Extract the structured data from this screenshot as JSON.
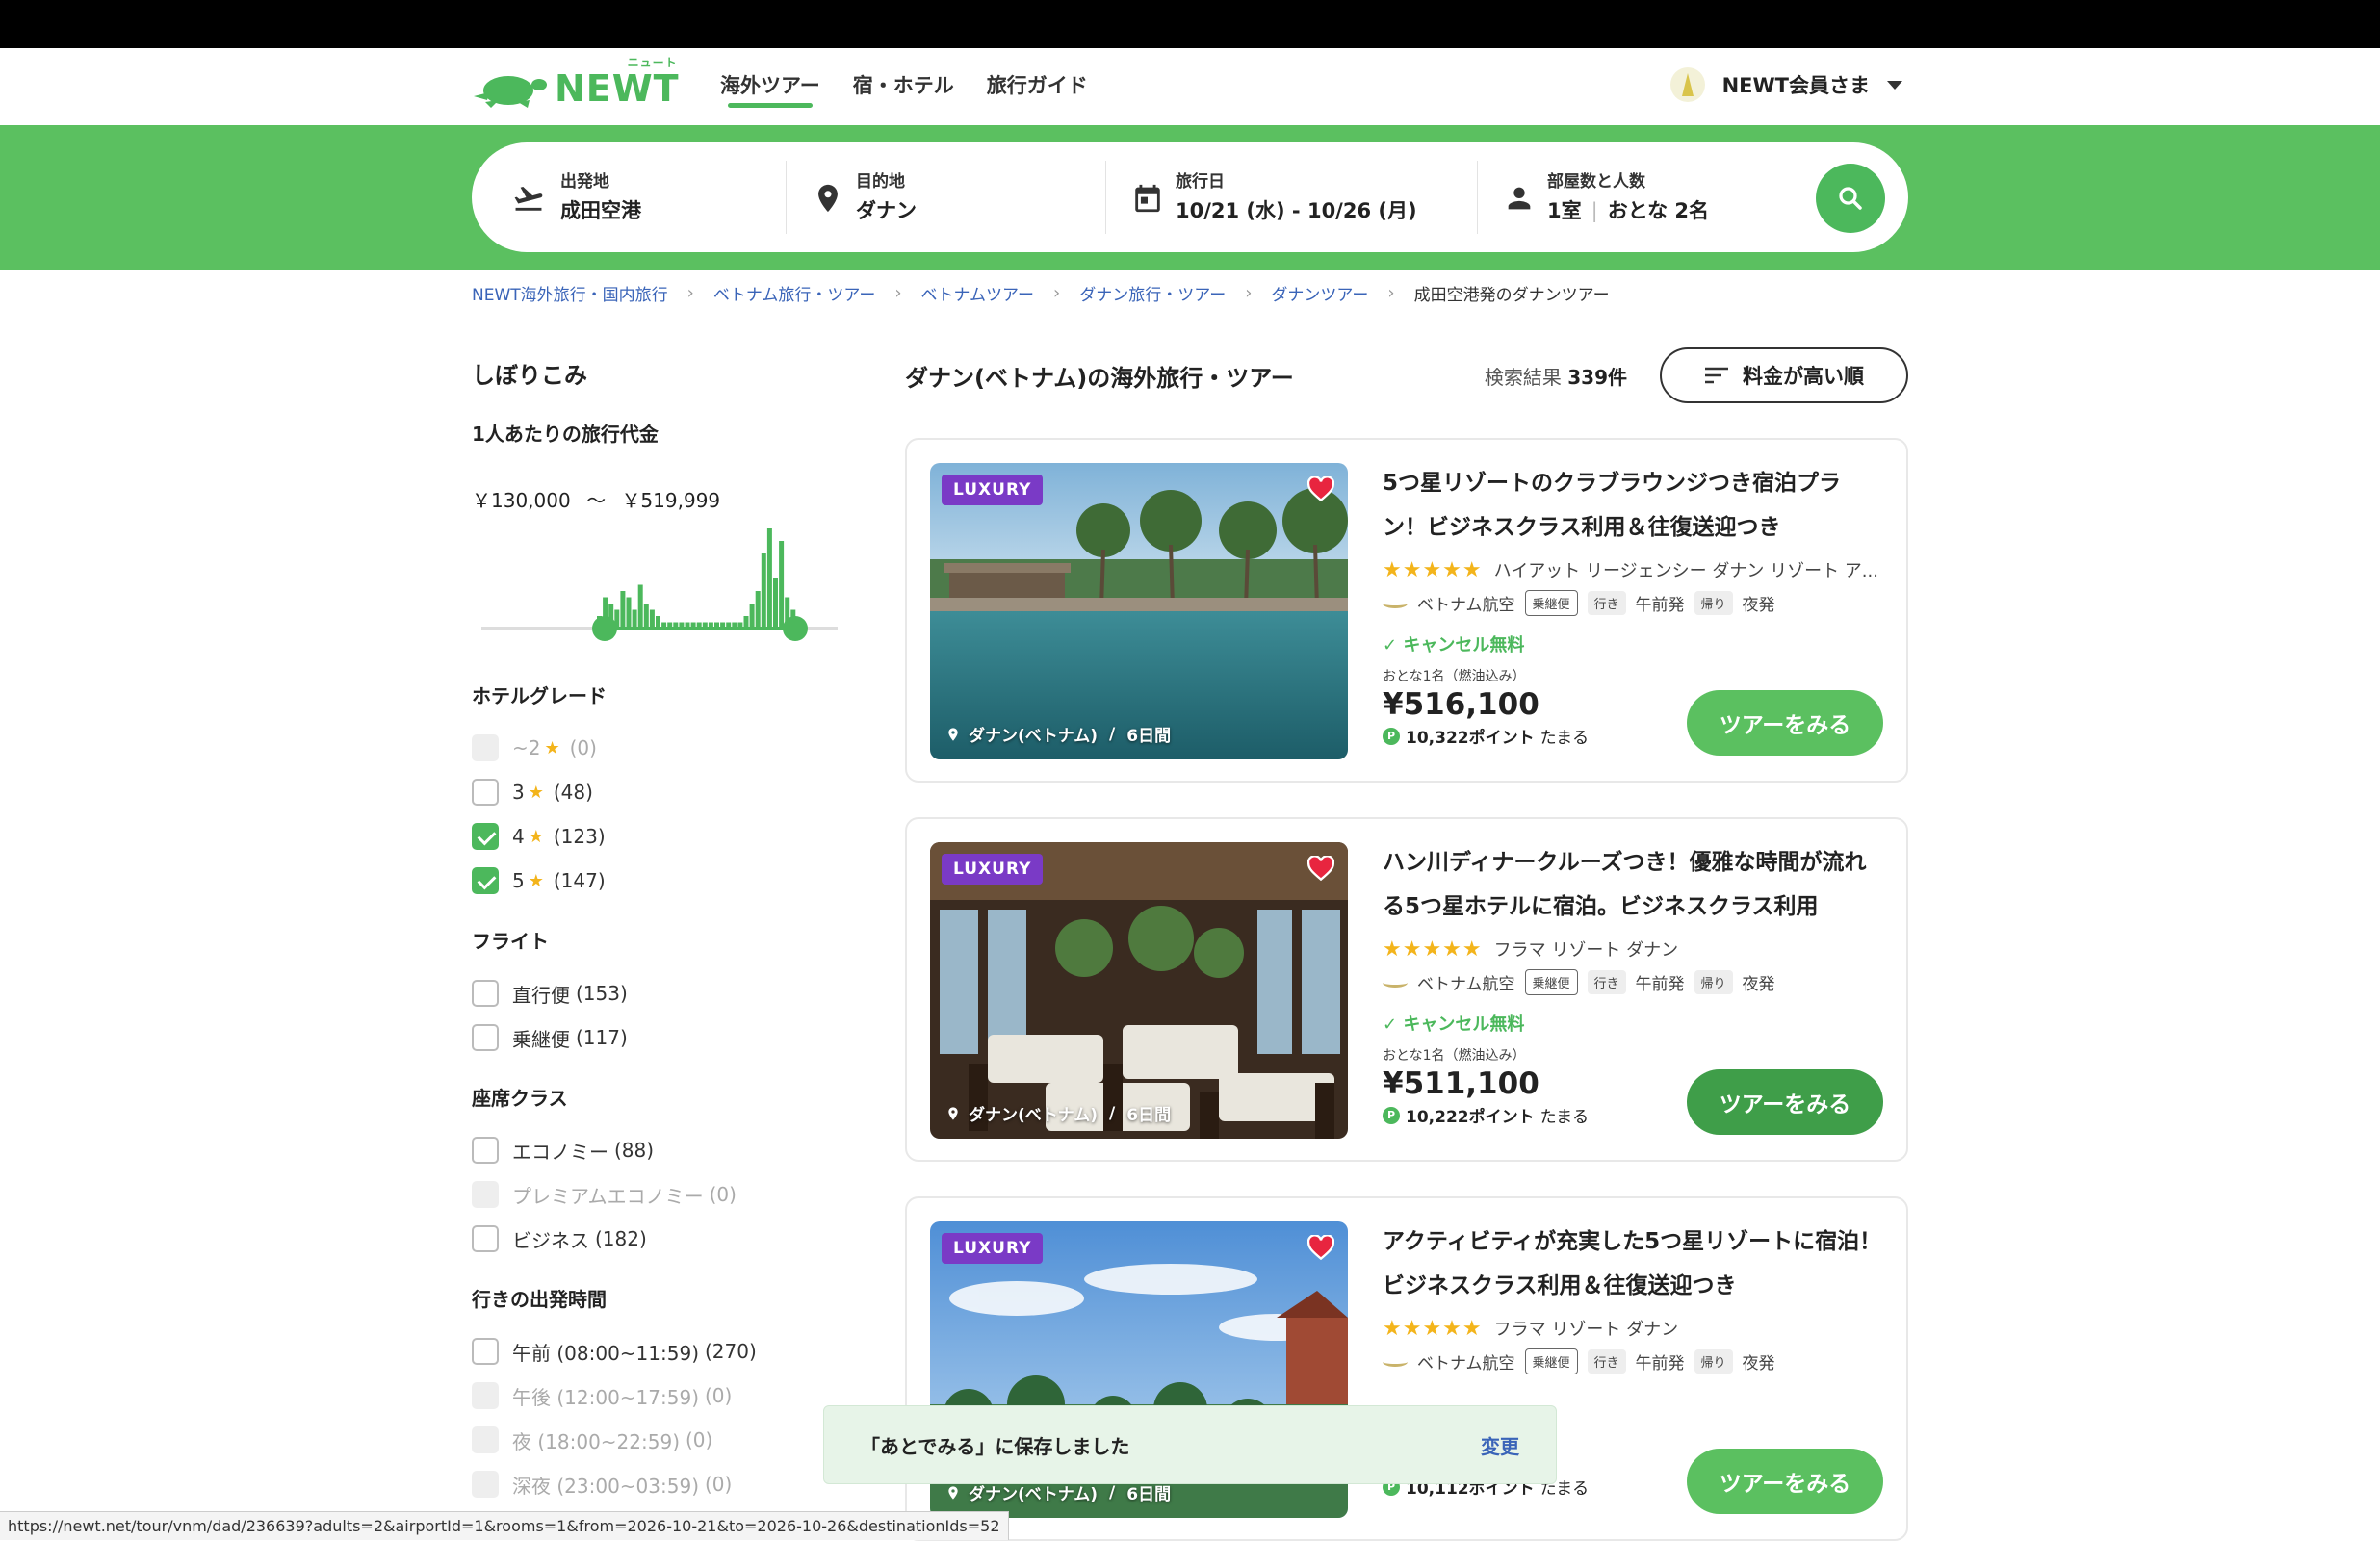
{
  "header": {
    "logo_text": "NEWT",
    "logo_ruby": "ニュート",
    "nav": [
      {
        "label": "海外ツアー",
        "active": true
      },
      {
        "label": "宿・ホテル",
        "active": false
      },
      {
        "label": "旅行ガイド",
        "active": false
      }
    ],
    "user_label": "NEWT会員さま"
  },
  "search": {
    "origin": {
      "label": "出発地",
      "value": "成田空港"
    },
    "destination": {
      "label": "目的地",
      "value": "ダナン"
    },
    "dates": {
      "label": "旅行日",
      "value": "10/21 (水) - 10/26 (月)"
    },
    "guests": {
      "label": "部屋数と人数",
      "rooms": "1室",
      "people": "おとな 2名"
    }
  },
  "breadcrumb": [
    "NEWT海外旅行・国内旅行",
    "ベトナム旅行・ツアー",
    "ベトナムツアー",
    "ダナン旅行・ツアー",
    "ダナンツアー",
    "成田空港発のダナンツアー"
  ],
  "sidebar": {
    "title": "しぼりこみ",
    "price_label": "1人あたりの旅行代金",
    "price_min": "￥130,000",
    "price_sep": "〜",
    "price_max": "￥519,999",
    "histogram": [
      2,
      5,
      4,
      3,
      6,
      5,
      3,
      7,
      4,
      3,
      2,
      1,
      1,
      1,
      1,
      1,
      1,
      1,
      1,
      1,
      1,
      1,
      1,
      1,
      1,
      2,
      4,
      6,
      12,
      16,
      8,
      14,
      5,
      3
    ],
    "groups": [
      {
        "title": "ホテルグレード",
        "items": [
          {
            "label": "~2",
            "star": true,
            "count": "(0)",
            "checked": false,
            "disabled": true
          },
          {
            "label": "3",
            "star": true,
            "count": "(48)",
            "checked": false,
            "disabled": false
          },
          {
            "label": "4",
            "star": true,
            "count": "(123)",
            "checked": true,
            "disabled": false
          },
          {
            "label": "5",
            "star": true,
            "count": "(147)",
            "checked": true,
            "disabled": false
          }
        ]
      },
      {
        "title": "フライト",
        "items": [
          {
            "label": "直行便",
            "count": "(153)",
            "checked": false,
            "disabled": false
          },
          {
            "label": "乗継便",
            "count": "(117)",
            "checked": false,
            "disabled": false
          }
        ]
      },
      {
        "title": "座席クラス",
        "items": [
          {
            "label": "エコノミー",
            "count": "(88)",
            "checked": false,
            "disabled": false
          },
          {
            "label": "プレミアムエコノミー",
            "count": "(0)",
            "checked": false,
            "disabled": true
          },
          {
            "label": "ビジネス",
            "count": "(182)",
            "checked": false,
            "disabled": false
          }
        ]
      },
      {
        "title": "行きの出発時間",
        "items": [
          {
            "label": "午前 (08:00~11:59)",
            "count": "(270)",
            "checked": false,
            "disabled": false
          },
          {
            "label": "午後 (12:00~17:59)",
            "count": "(0)",
            "checked": false,
            "disabled": true
          },
          {
            "label": "夜 (18:00~22:59)",
            "count": "(0)",
            "checked": false,
            "disabled": true
          },
          {
            "label": "深夜 (23:00~03:59)",
            "count": "(0)",
            "checked": false,
            "disabled": true
          }
        ]
      }
    ]
  },
  "results": {
    "title": "ダナン(ベトナム)の海外旅行・ツアー",
    "count_label": "検索結果",
    "count": "339件",
    "sort_label": "料金が高い順",
    "cards": [
      {
        "badge": "LUXURY",
        "location": "ダナン(ベトナム)",
        "duration": "6日間",
        "title": "5つ星リゾートのクラブラウンジつき宿泊プラン！ビジネスクラス利用＆往復送迎つき",
        "stars": "★★★★★",
        "hotel": "ハイアット リージェンシー ダナン リゾート ア...",
        "airline": "ベトナム航空",
        "flight_type": "乗継便",
        "out_tag": "行き",
        "out_time": "午前発",
        "ret_tag": "帰り",
        "ret_time": "夜発",
        "cancel": "キャンセル無料",
        "pax": "おとな1名（燃油込み）",
        "price": "¥516,100",
        "points": "10,322ポイント",
        "points_suffix": "たまる",
        "button": "ツアーをみる",
        "photo": "pool"
      },
      {
        "badge": "LUXURY",
        "location": "ダナン(ベトナム)",
        "duration": "6日間",
        "title": "ハン川ディナークルーズつき！優雅な時間が流れる5つ星ホテルに宿泊。ビジネスクラス利用",
        "stars": "★★★★★",
        "hotel": "フラマ リゾート ダナン",
        "airline": "ベトナム航空",
        "flight_type": "乗継便",
        "out_tag": "行き",
        "out_time": "午前発",
        "ret_tag": "帰り",
        "ret_time": "夜発",
        "cancel": "キャンセル無料",
        "pax": "おとな1名（燃油込み）",
        "price": "¥511,100",
        "points": "10,222ポイント",
        "points_suffix": "たまる",
        "button": "ツアーをみる",
        "photo": "restaurant"
      },
      {
        "badge": "LUXURY",
        "location": "ダナン(ベトナム)",
        "duration": "6日間",
        "title": "アクティビティが充実した5つ星リゾートに宿泊！ビジネスクラス利用＆往復送迎つき",
        "stars": "★★★★★",
        "hotel": "フラマ リゾート ダナン",
        "airline": "ベトナム航空",
        "flight_type": "乗継便",
        "out_tag": "行き",
        "out_time": "午前発",
        "ret_tag": "帰り",
        "ret_time": "夜発",
        "cancel": "",
        "pax": "",
        "price": "",
        "points": "10,112ポイント",
        "points_suffix": "たまる",
        "button": "ツアーをみる",
        "photo": "beach"
      }
    ]
  },
  "toast": {
    "message": "「あとでみる」に保存しました",
    "action": "変更"
  },
  "statusbar": {
    "url": "https://newt.net/tour/vnm/dad/236639?adults=2&airportId=1&rooms=1&from=2026-10-21&to=2026-10-26&destinationIds=52"
  },
  "colors": {
    "brand": "#4cb85c",
    "band": "#5bc060",
    "luxury": "#7a3ac6",
    "link": "#3a64b8"
  }
}
